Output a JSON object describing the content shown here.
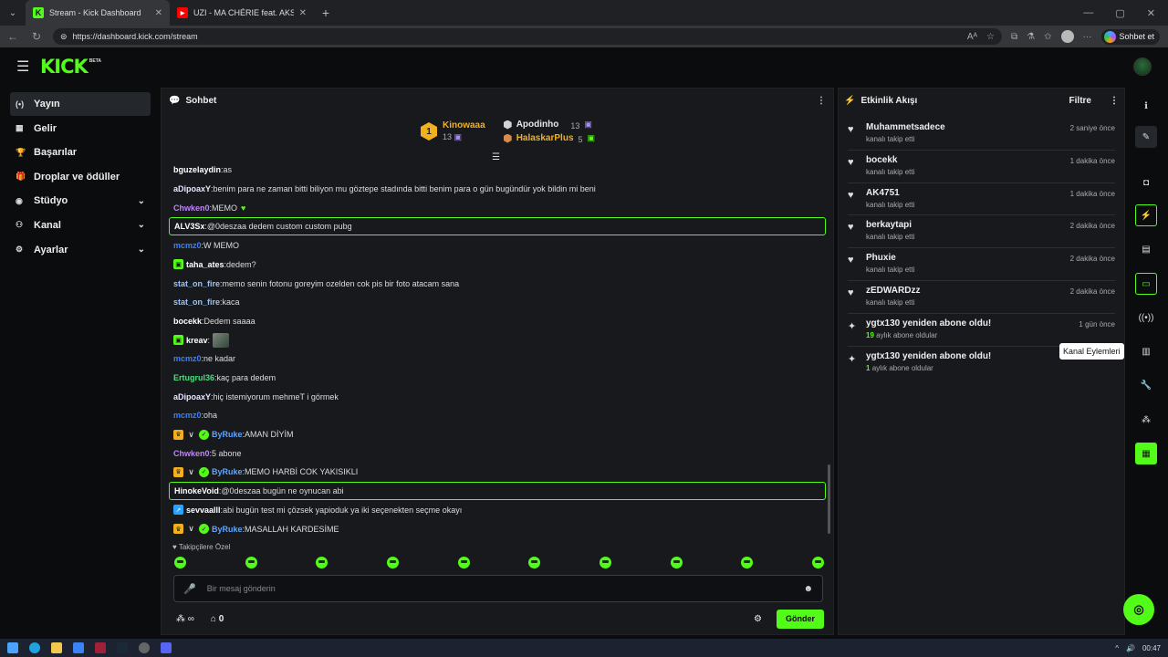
{
  "browser": {
    "tabs": [
      {
        "title": "Stream - Kick Dashboard",
        "active": true
      },
      {
        "title": "UZI - MA CHÉRIE feat. AKSAN",
        "active": false
      }
    ],
    "url": "https://dashboard.kick.com/stream",
    "copilot_label": "Sohbet et"
  },
  "header": {
    "logo": "KICK",
    "beta": "BETA"
  },
  "sidebar": {
    "items": [
      {
        "label": "Yayın",
        "icon": "(•)",
        "active": true,
        "chevron": false
      },
      {
        "label": "Gelir",
        "icon": "▦",
        "chevron": false
      },
      {
        "label": "Başarılar",
        "icon": "🏆",
        "chevron": false
      },
      {
        "label": "Droplar ve ödüller",
        "icon": "🎁",
        "chevron": false
      },
      {
        "label": "Stüdyo",
        "icon": "◉",
        "chevron": true
      },
      {
        "label": "Kanal",
        "icon": "⚇",
        "chevron": true
      },
      {
        "label": "Ayarlar",
        "icon": "⚙",
        "chevron": true
      }
    ]
  },
  "chat": {
    "title": "Sohbet",
    "top_gifters": {
      "first": {
        "rank": "1",
        "name": "Kinowaaa",
        "count": "13"
      },
      "second": {
        "name": "Apodinho",
        "count": "13"
      },
      "third": {
        "name": "HalaskarPlus",
        "count": "5"
      }
    },
    "messages": [
      {
        "user": "bguzelaydin",
        "color": "#ffffff",
        "text": "as"
      },
      {
        "user": "aDipoaxY",
        "color": "#e6e6ff",
        "text": "benim para ne zaman bitti biliyon mu göztepe stadında bitti benim para o gün bugündür yok bildin mi beni"
      },
      {
        "user": "Chwken0",
        "color": "#c084fc",
        "text": "MEMO"
      },
      {
        "user": "ALV3Sx",
        "color": "#ffffff",
        "text": "@0deszaa dedem custom custom pubg"
      },
      {
        "user": "mcmz0",
        "color": "#3b82f6",
        "text": "W MEMO"
      },
      {
        "user": "taha_ates",
        "color": "#ffffff",
        "text": "dedem?"
      },
      {
        "user": "stat_on_fire",
        "color": "#93c5fd",
        "text": "memo senin fotonu goreyim ozelden cok pis bir foto atacam sana"
      },
      {
        "user": "stat_on_fire",
        "color": "#93c5fd",
        "text": "kaca"
      },
      {
        "user": "bocekk",
        "color": "#ffffff",
        "text": "Dedem saaaa"
      },
      {
        "user": "kreav",
        "color": "#ffffff",
        "text": ""
      },
      {
        "user": "mcmz0",
        "color": "#3b82f6",
        "text": "ne kadar"
      },
      {
        "user": "Ertugrul36",
        "color": "#4ade80",
        "text": "kaç para dedem"
      },
      {
        "user": "aDipoaxY",
        "color": "#e6e6ff",
        "text": "hiç istemiyorum mehmeT i görmek"
      },
      {
        "user": "mcmz0",
        "color": "#3b82f6",
        "text": "oha"
      },
      {
        "user": "ByRuke",
        "color": "#60a5fa",
        "text": "AMAN DİYİM"
      },
      {
        "user": "Chwken0",
        "color": "#c084fc",
        "text": "5 abone"
      },
      {
        "user": "ByRuke",
        "color": "#60a5fa",
        "text": "MEMO HARBİ COK YAKISIKLI"
      },
      {
        "user": "HinokeVoid",
        "color": "#ffffff",
        "text": "@0deszaa bugün ne oynucan abi"
      },
      {
        "user": "sevvaalll",
        "color": "#ffffff",
        "text": "abi bugün test mi çözsek yapioduk ya iki seçenekten seçme okayı"
      },
      {
        "user": "ByRuke",
        "color": "#60a5fa",
        "text": "MASALLAH KARDESİME"
      }
    ],
    "followers_only": "Takipçilere Özel",
    "input_placeholder": "Bir mesaj gönderin",
    "footer": {
      "infinity": "∞",
      "count": "0",
      "send_label": "Gönder"
    }
  },
  "activity": {
    "title": "Etkinlik Akışı",
    "filter_label": "Filtre",
    "items": [
      {
        "icon": "heart",
        "name": "Muhammetsadece",
        "sub": "kanalı takip etti",
        "time": "2 saniye önce"
      },
      {
        "icon": "heart",
        "name": "bocekk",
        "sub": "kanalı takip etti",
        "time": "1 dakika önce"
      },
      {
        "icon": "heart",
        "name": "AK4751",
        "sub": "kanalı takip etti",
        "time": "1 dakika önce"
      },
      {
        "icon": "heart",
        "name": "berkaytapi",
        "sub": "kanalı takip etti",
        "time": "2 dakika önce"
      },
      {
        "icon": "heart",
        "name": "Phuxie",
        "sub": "kanalı takip etti",
        "time": "2 dakika önce"
      },
      {
        "icon": "heart",
        "name": "zEDWARDzz",
        "sub": "kanalı takip etti",
        "time": "2 dakika önce"
      },
      {
        "icon": "sparkle",
        "name": "ygtx130 yeniden abone oldu!",
        "sub_num": "19",
        "sub": "aylık abone oldular",
        "time": "1 gün önce"
      },
      {
        "icon": "sparkle",
        "name": "ygtx130 yeniden abone oldu!",
        "sub_num": "1",
        "sub": "aylık abone oldular",
        "time": ""
      }
    ]
  },
  "rail": {
    "tooltip": "Kanal Eylemleri"
  },
  "taskbar": {
    "time": "00:47"
  },
  "colors": {
    "accent": "#53fc18",
    "panel": "#18191d",
    "bg": "#0b0c0e"
  }
}
